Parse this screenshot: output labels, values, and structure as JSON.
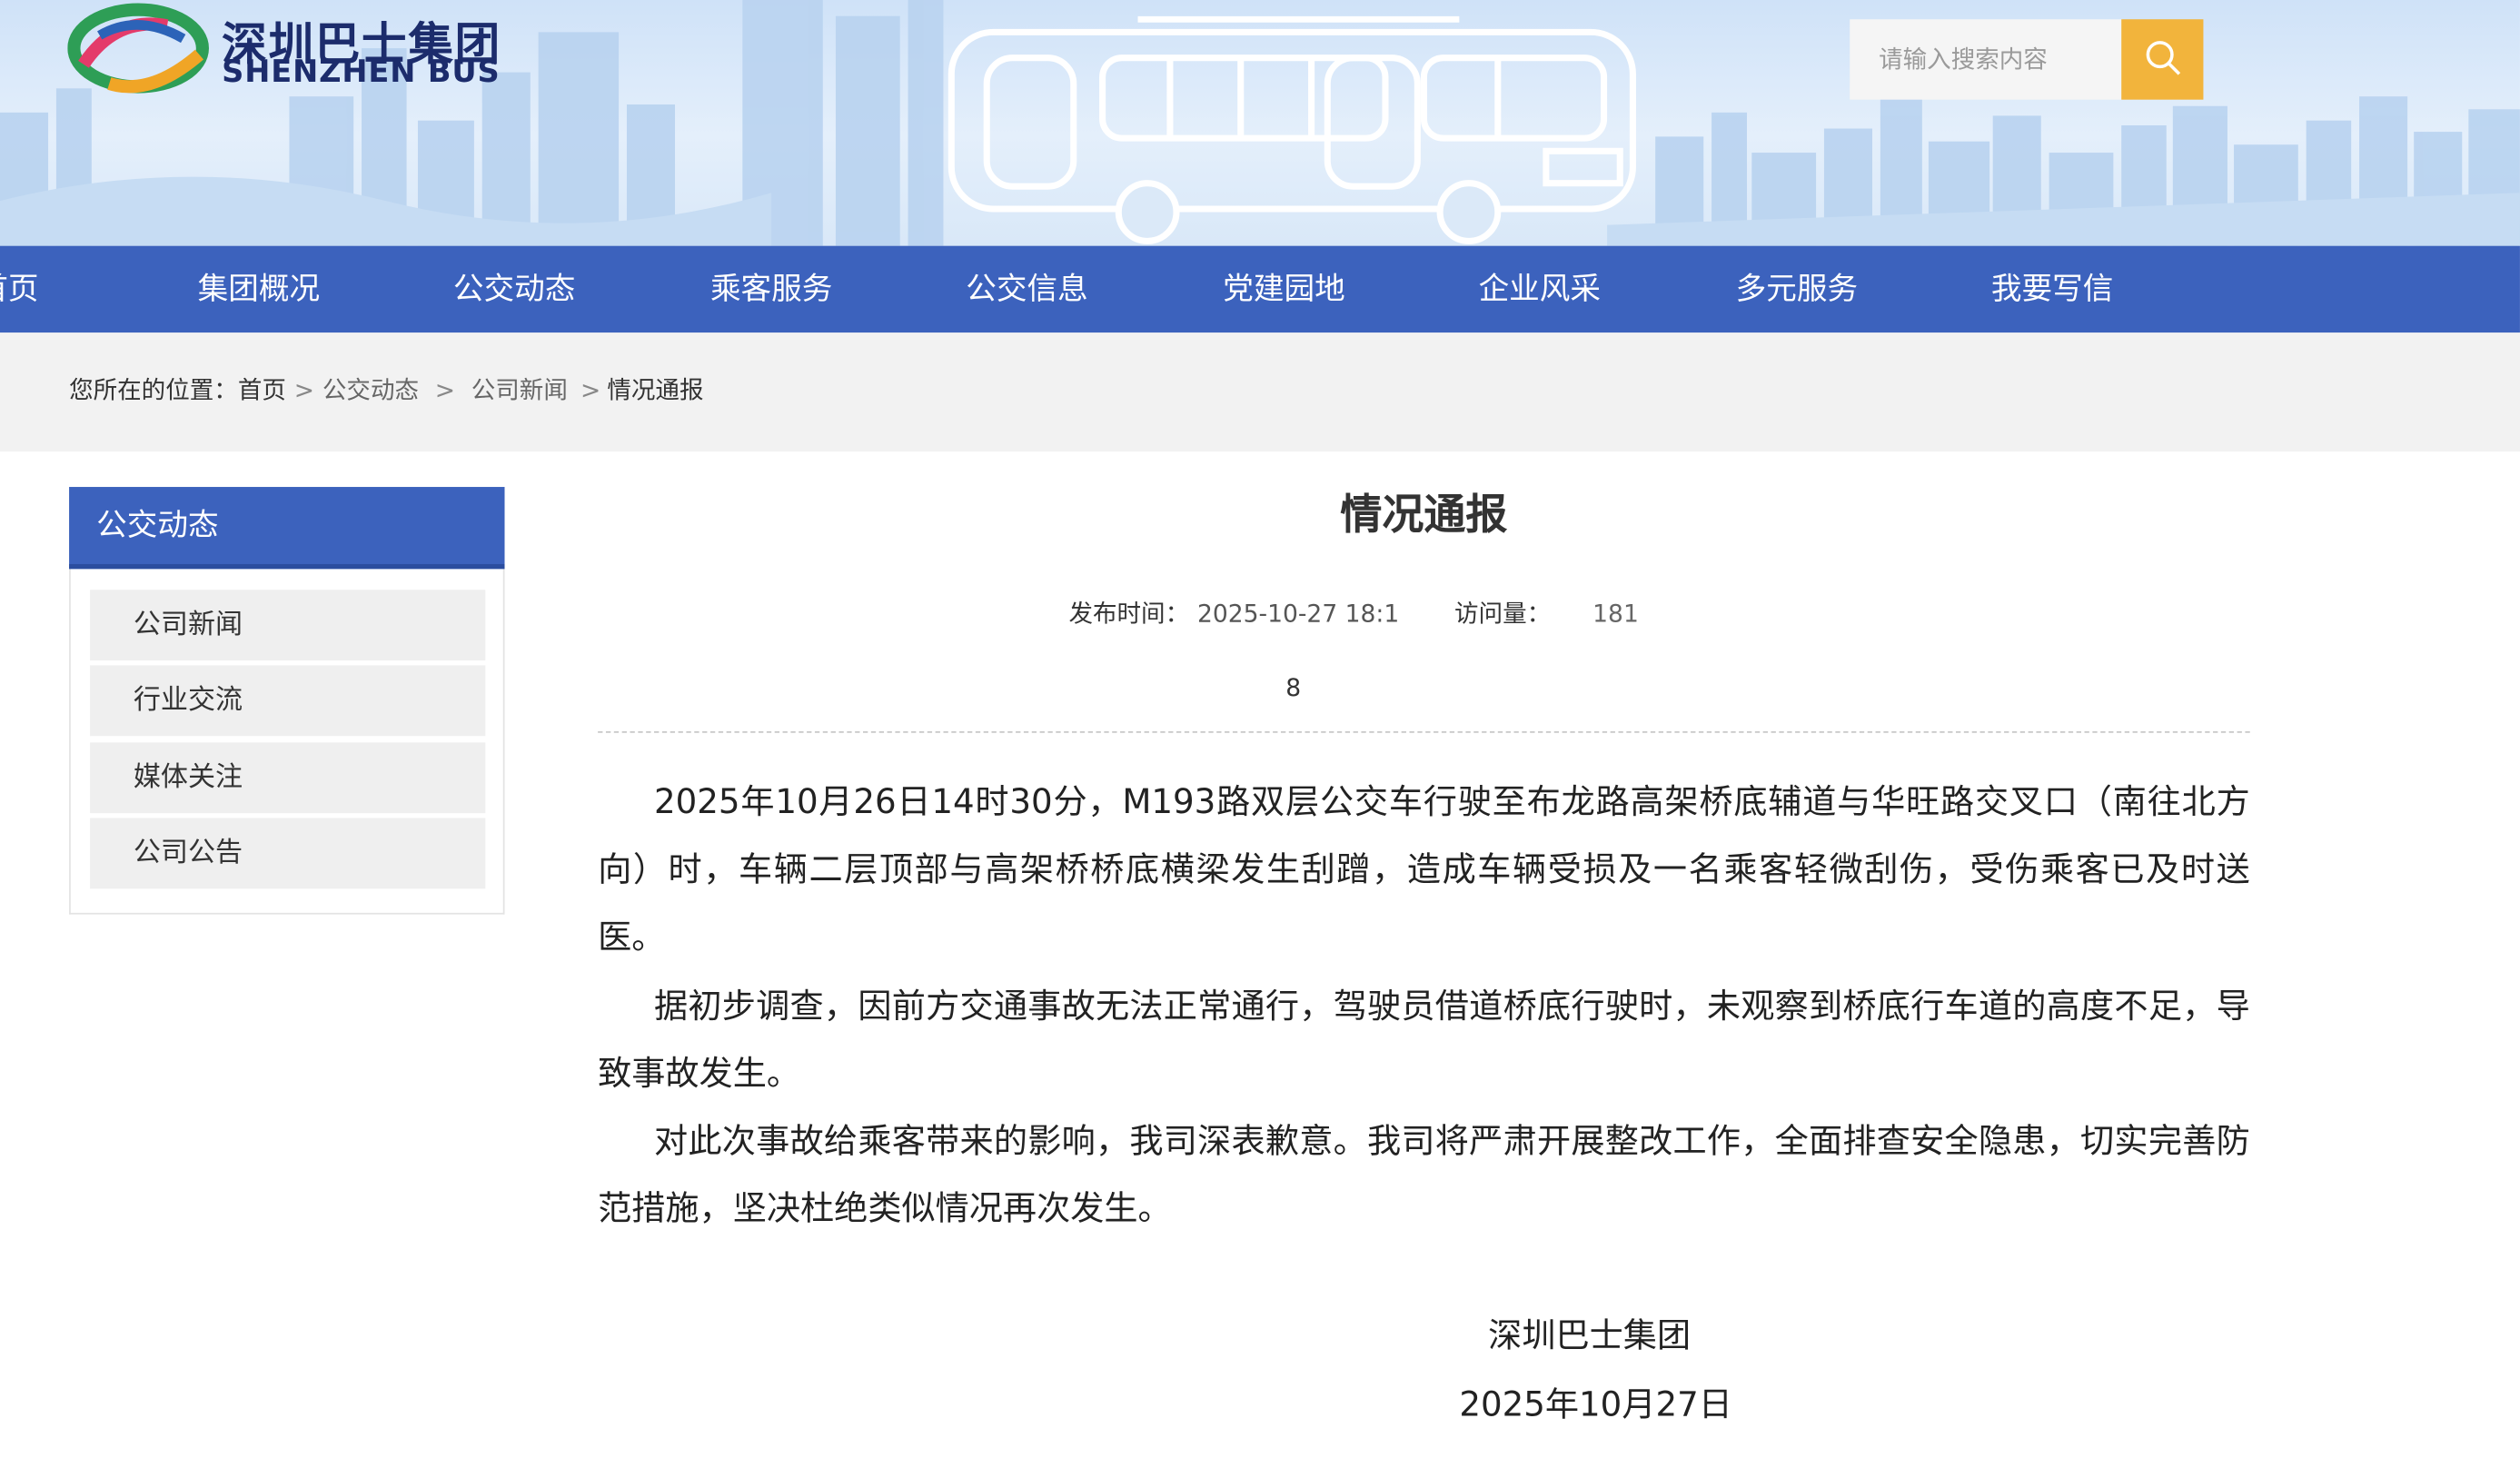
{
  "header": {
    "logo_cn": "深圳巴士集团",
    "logo_en": "SHENZHEN BUS",
    "search_placeholder": "请输入搜索内容"
  },
  "nav": {
    "items": [
      "首页",
      "集团概况",
      "公交动态",
      "乘客服务",
      "公交信息",
      "党建园地",
      "企业风采",
      "多元服务",
      "我要写信"
    ]
  },
  "breadcrumb": {
    "prefix": "您所在的位置：",
    "items": [
      "首页",
      "公交动态",
      "公司新闻",
      "情况通报"
    ],
    "sep": ">"
  },
  "sidebar": {
    "title": "公交动态",
    "items": [
      "公司新闻",
      "行业交流",
      "媒体关注",
      "公司公告"
    ]
  },
  "article": {
    "title": "情况通报",
    "publish_label": "发布时间：",
    "publish_value": "2025-10-27 18:1",
    "views_label": "访问量：",
    "views_value": "181",
    "views_tail": "8",
    "paragraphs": [
      "2025年10月26日14时30分，M193路双层公交车行驶至布龙路高架桥底辅道与华旺路交叉口（南往北方向）时，车辆二层顶部与高架桥桥底横梁发生刮蹭，造成车辆受损及一名乘客轻微刮伤，受伤乘客已及时送医。",
      "据初步调查，因前方交通事故无法正常通行，驾驶员借道桥底行驶时，未观察到桥底行车道的高度不足，导致事故发生。",
      "对此次事故给乘客带来的影响，我司深表歉意。我司将严肃开展整改工作，全面排查安全隐患，切实完善防范措施，坚决杜绝类似情况再次发生。"
    ],
    "signature": "深圳巴士集团",
    "sign_date": "2025年10月27日"
  },
  "colors": {
    "nav_blue": "#3c62bd",
    "search_button": "#f2b43c",
    "breadcrumb_bg": "#f2f2f2"
  }
}
